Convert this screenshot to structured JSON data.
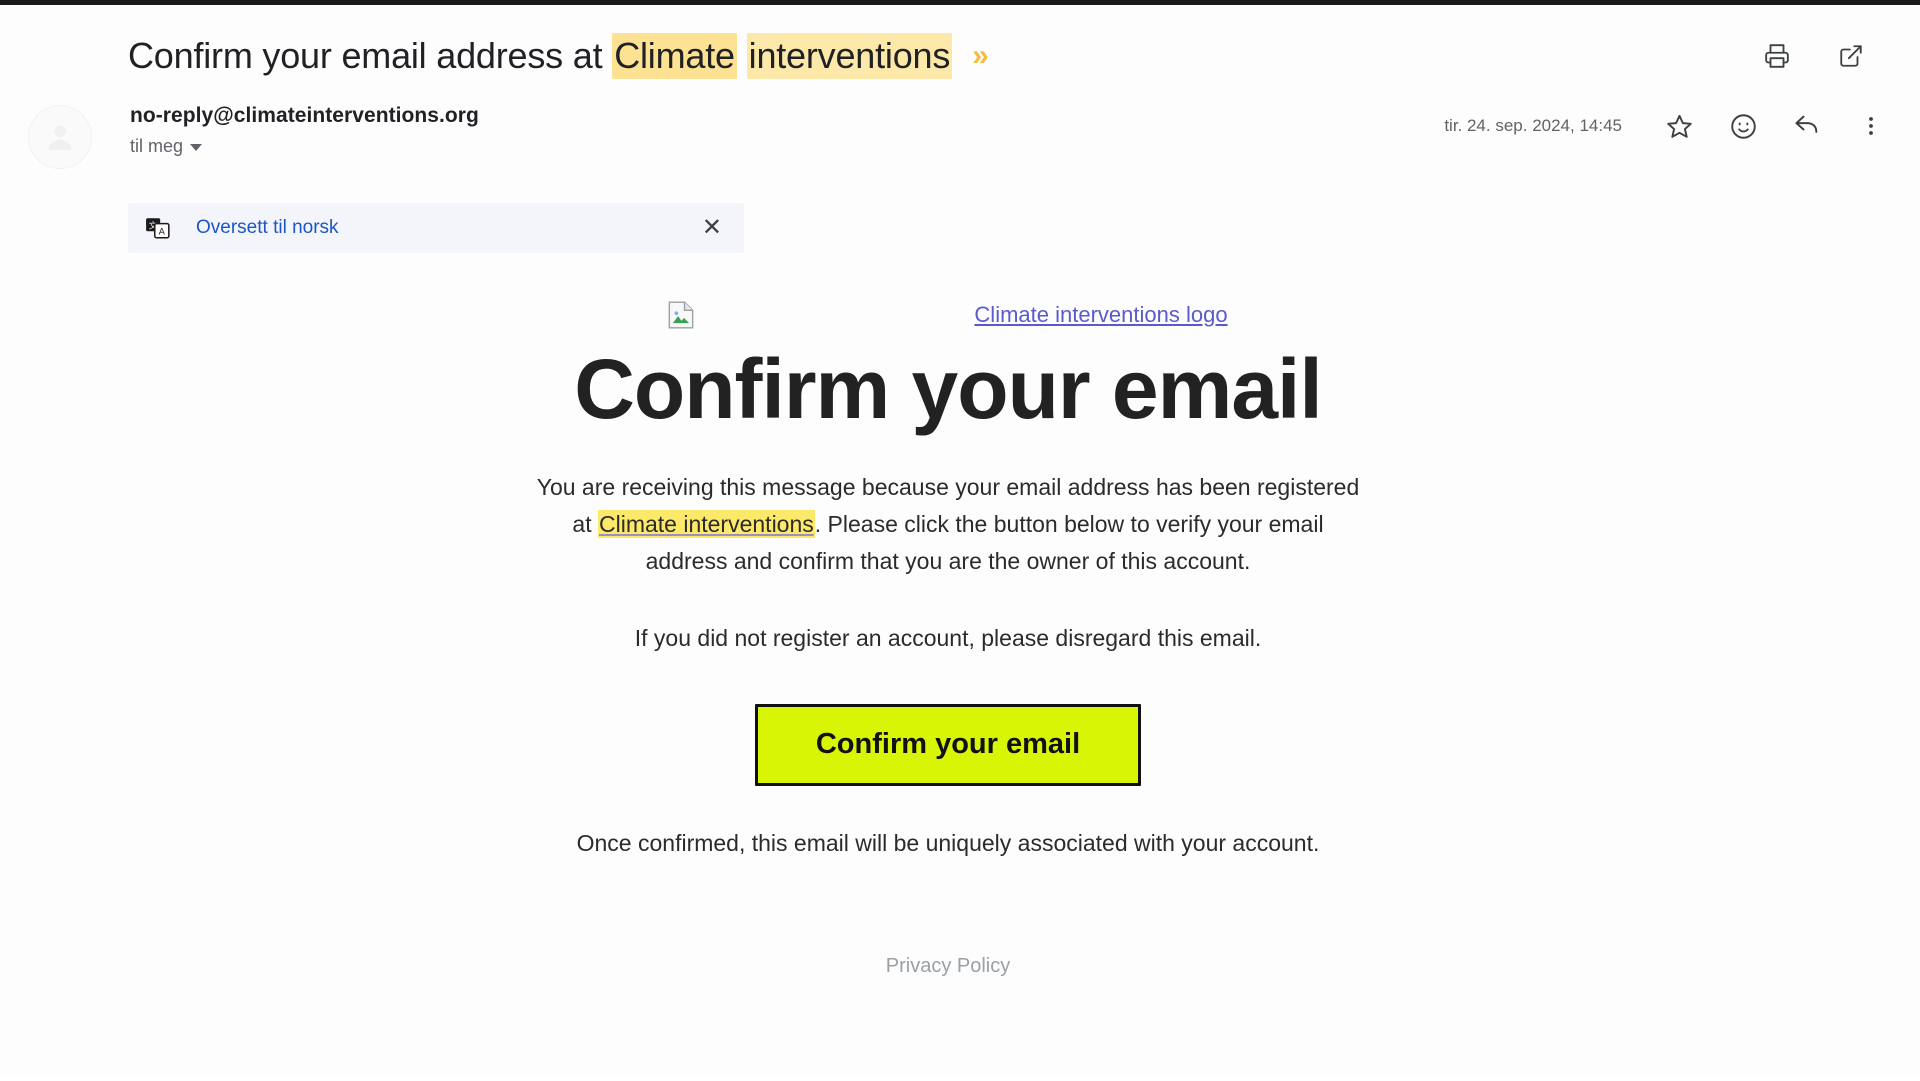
{
  "window": {
    "frame_color": "#1a1a1a"
  },
  "subject": {
    "prefix": "Confirm your email address at ",
    "highlight_1": "Climate",
    "highlight_2": "interventions",
    "important_marker": "»",
    "marker_color": "#f5bb42",
    "highlight_color": "#fde293"
  },
  "header_actions": [
    {
      "name": "print-icon",
      "label": "Print"
    },
    {
      "name": "open-in-new-icon",
      "label": "Open in new window"
    }
  ],
  "sender": {
    "email": "no-reply@climateinterventions.org",
    "recipient": "til meg",
    "date": "tir. 24. sep. 2024, 14:45"
  },
  "meta_actions": [
    {
      "name": "star-icon",
      "label": "Star"
    },
    {
      "name": "emoji-icon",
      "label": "Add reaction"
    },
    {
      "name": "reply-icon",
      "label": "Reply"
    },
    {
      "name": "more-options-icon",
      "label": "More"
    }
  ],
  "translate_bar": {
    "link": "Oversett til norsk",
    "close": "✕",
    "link_color": "#1a56c5",
    "background": "#f4f5fa"
  },
  "email": {
    "logo_alt": "Climate interventions logo",
    "heading": "Confirm your email",
    "paragraph_1_part_1": "You are receiving this message because your email address has been registered at ",
    "paragraph_1_link": "Climate interventions",
    "paragraph_1_part_2": ". Please click the button below to verify your email address and confirm that you are the owner of this account.",
    "paragraph_2": "If you did not register an account, please disregard this email.",
    "cta_label": "Confirm your email",
    "cta_background": "#d7f505",
    "cta_border": "#111111",
    "post_cta": "Once confirmed, this email will be uniquely associated with your account.",
    "privacy_policy": "Privacy Policy",
    "link_color": "#5a5acd",
    "inline_highlight": "#fce96a"
  }
}
